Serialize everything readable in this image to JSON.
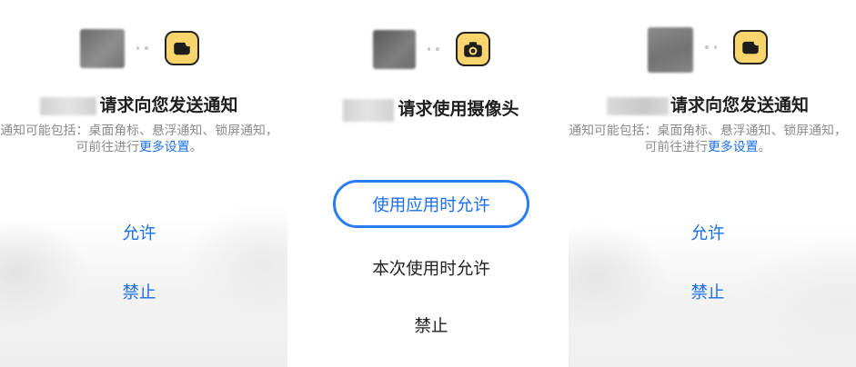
{
  "colors": {
    "accent": "#1c6fe8",
    "focus_outline": "#2a7cf6",
    "primary_text": "#1f1f1f",
    "secondary_text": "#8c8c8c",
    "permission_icon_bg": "#f8d46c"
  },
  "dialogs": [
    {
      "permission_icon": "notification-icon",
      "title": "请求向您发送通知",
      "description": {
        "line1": "通知可能包括：桌面角标、悬浮通知、锁屏通知，",
        "line2_prefix": "可前往进行",
        "link": "更多设置",
        "line2_suffix": "。"
      },
      "options": [
        {
          "label": "允许"
        },
        {
          "label": "禁止"
        }
      ]
    },
    {
      "permission_icon": "camera-icon",
      "title": "请求使用摄像头",
      "options": [
        {
          "label": "使用应用时允许"
        },
        {
          "label": "本次使用时允许"
        },
        {
          "label": "禁止"
        }
      ]
    },
    {
      "permission_icon": "notification-icon",
      "title": "请求向您发送通知",
      "description": {
        "line1": "通知可能包括：桌面角标、悬浮通知、锁屏通知，",
        "line2_prefix": "可前往进行",
        "link": "更多设置",
        "line2_suffix": "。"
      },
      "options": [
        {
          "label": "允许"
        },
        {
          "label": "禁止"
        }
      ]
    }
  ]
}
